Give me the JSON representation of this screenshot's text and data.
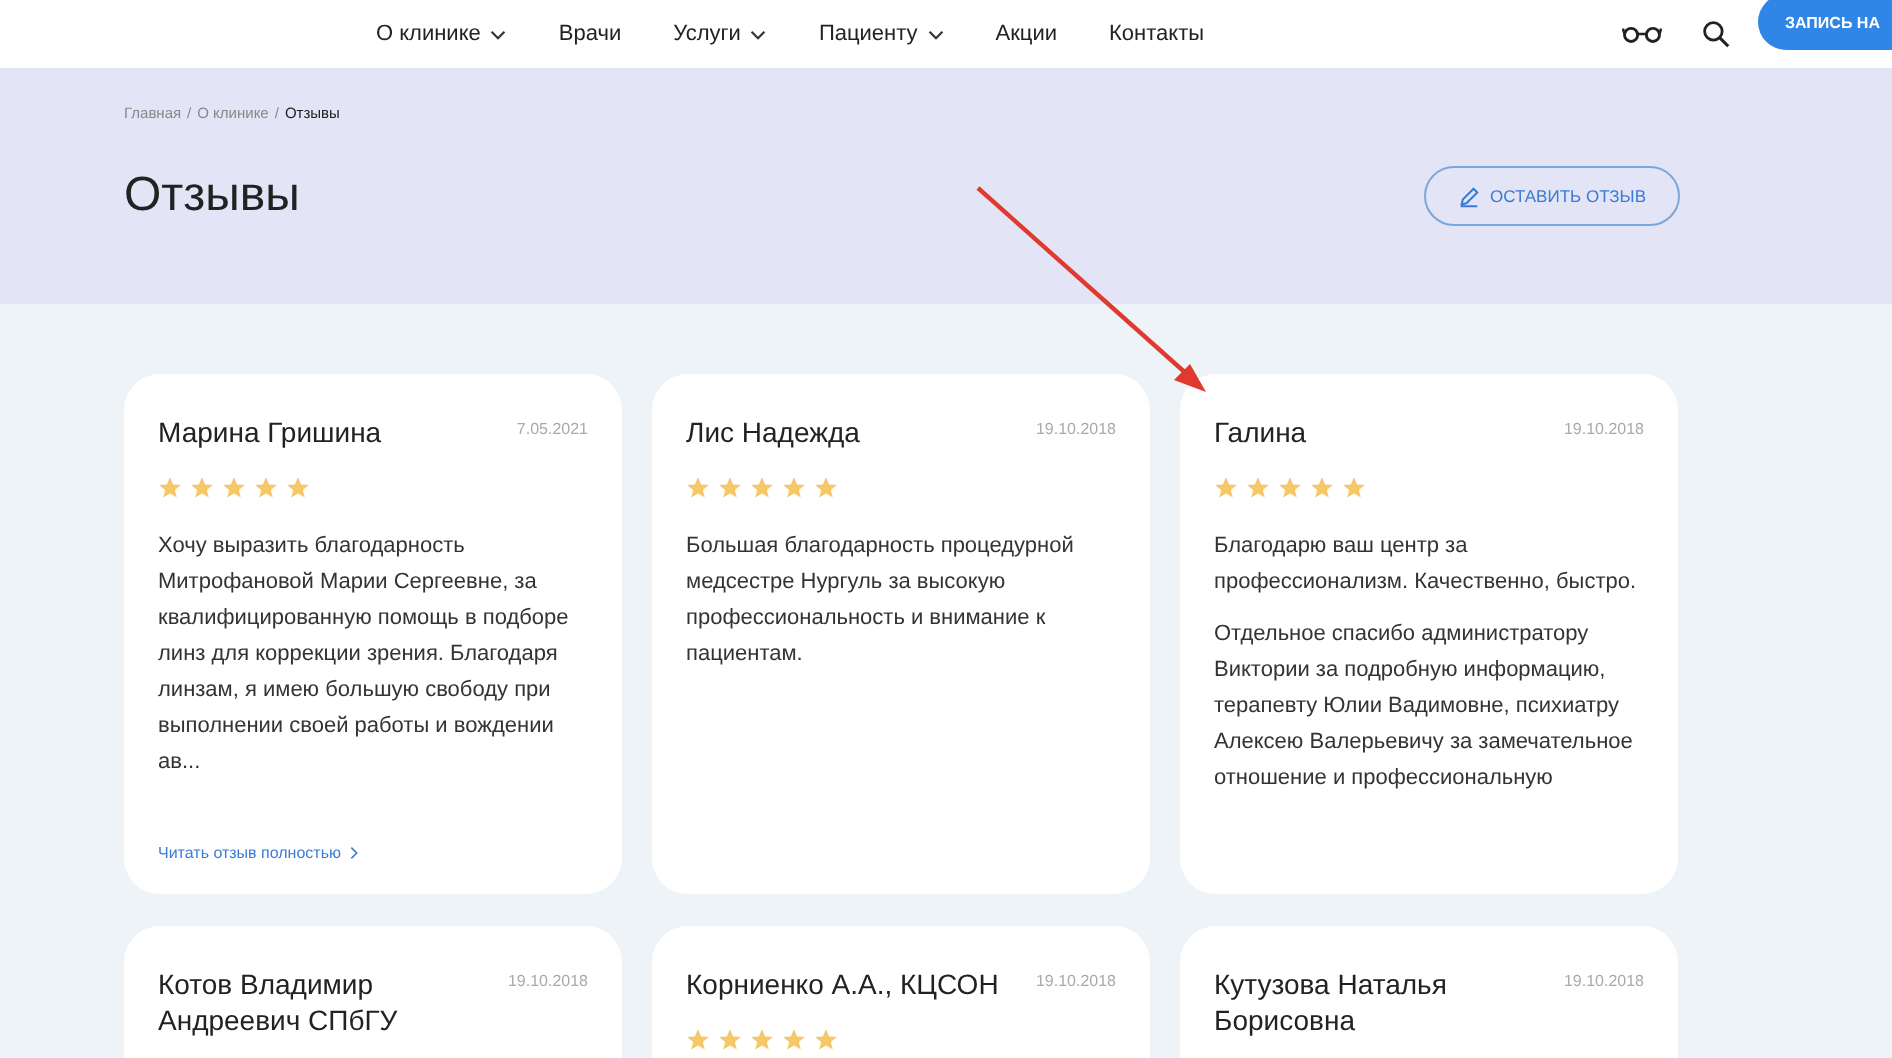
{
  "nav": {
    "items": [
      {
        "label": "О клинике",
        "dropdown": true
      },
      {
        "label": "Врачи",
        "dropdown": false
      },
      {
        "label": "Услуги",
        "dropdown": true
      },
      {
        "label": "Пациенту",
        "dropdown": true
      },
      {
        "label": "Акции",
        "dropdown": false
      },
      {
        "label": "Контакты",
        "dropdown": false
      }
    ],
    "cta": "ЗАПИСЬ НА"
  },
  "breadcrumbs": [
    {
      "label": "Главная",
      "current": false
    },
    {
      "separator": "/",
      "label": "О клинике",
      "current": false
    },
    {
      "separator": "/",
      "label": "Отзывы",
      "current": true
    }
  ],
  "title": "Отзывы",
  "action_button": "ОСТАВИТЬ ОТЗЫВ",
  "reviews": [
    {
      "author": "Марина Гришина",
      "date": "7.05.2021",
      "stars": 5,
      "paragraphs": [
        "Хочу выразить благодарность Митрофановой Марии Сергеевне, за квалифицированную помощь в подборе линз для коррекции зрения. Благодаря линзам, я имею большую свободу при выполнении своей работы и вождении ав..."
      ],
      "read_more": "Читать отзыв полностью"
    },
    {
      "author": "Лис Надежда",
      "date": "19.10.2018",
      "stars": 5,
      "paragraphs": [
        "Большая благодарность процедурной медсестре Нургуль за высокую профессиональность и внимание к пациентам."
      ]
    },
    {
      "author": "Галина",
      "date": "19.10.2018",
      "stars": 5,
      "paragraphs": [
        "Благодарю ваш центр за профессионализм. Качественно, быстро.",
        "Отдельное спасибо администратору Виктории за подробную информацию, терапевту Юлии Вадимовне, психиатру Алексею Валерьевичу за замечательное отношение и профессиональную"
      ]
    },
    {
      "author": "Котов Владимир Андреевич СПбГУ",
      "date": "19.10.2018"
    },
    {
      "author": "Корниенко А.А., КЦСОН",
      "date": "19.10.2018",
      "stars": 5
    },
    {
      "author": "Кутузова Наталья Борисовна",
      "date": "19.10.2018"
    }
  ]
}
